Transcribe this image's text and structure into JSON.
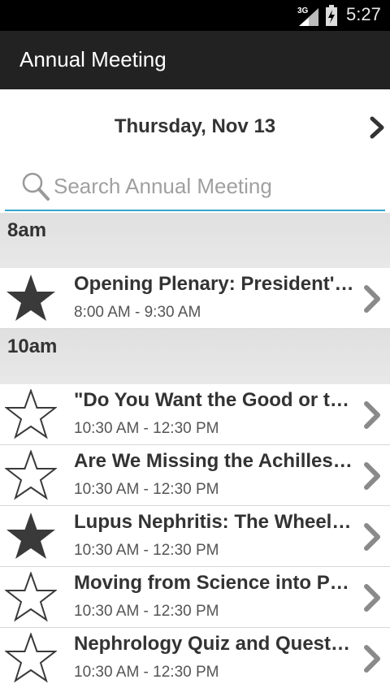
{
  "status_bar": {
    "network": "3G",
    "time": "5:27"
  },
  "action_bar": {
    "title": "Annual Meeting"
  },
  "date_nav": {
    "label": "Thursday, Nov 13"
  },
  "search": {
    "placeholder": "Search Annual Meeting",
    "value": ""
  },
  "sections": [
    {
      "label": "8am"
    },
    {
      "label": "10am"
    }
  ],
  "sessions": [
    {
      "title": "Opening Plenary: President's Address",
      "time": "8:00 AM - 9:30 AM",
      "starred": true
    },
    {
      "title": "\"Do You Want the Good or the Bad News First?\"",
      "time": "10:30 AM - 12:30 PM",
      "starred": false
    },
    {
      "title": "Are We Missing the Achilles Heel?",
      "time": "10:30 AM - 12:30 PM",
      "starred": false
    },
    {
      "title": "Lupus Nephritis: The Wheel Turns",
      "time": "10:30 AM - 12:30 PM",
      "starred": true
    },
    {
      "title": "Moving from Science into Practice",
      "time": "10:30 AM - 12:30 PM",
      "starred": false
    },
    {
      "title": "Nephrology Quiz and Questionnaire",
      "time": "10:30 AM - 12:30 PM",
      "starred": false
    }
  ],
  "colors": {
    "accent": "#33a6cc",
    "actionbar": "#222222",
    "section_bg": "#e4e4e4",
    "star_filled": "#3a3a3a"
  }
}
